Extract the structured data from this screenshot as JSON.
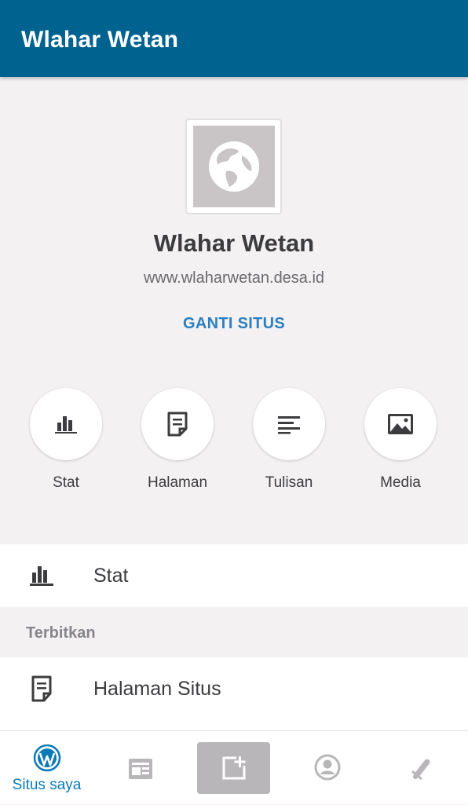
{
  "appbar": {
    "title": "Wlahar Wetan"
  },
  "site": {
    "name": "Wlahar Wetan",
    "url": "www.wlaharwetan.desa.id",
    "switch_label": "GANTI SITUS",
    "icon": "globe-icon"
  },
  "quick_actions": [
    {
      "label": "Stat",
      "icon": "bar-chart-icon"
    },
    {
      "label": "Halaman",
      "icon": "page-icon"
    },
    {
      "label": "Tulisan",
      "icon": "posts-icon"
    },
    {
      "label": "Media",
      "icon": "image-icon"
    }
  ],
  "list": {
    "stat_row": {
      "label": "Stat",
      "icon": "bar-chart-icon"
    },
    "publish_section": {
      "label": "Terbitkan"
    },
    "pages_row": {
      "label": "Halaman Situs",
      "icon": "page-icon"
    }
  },
  "bottom_nav": {
    "items": [
      {
        "label": "Situs saya",
        "icon": "wordpress-icon",
        "active": true
      },
      {
        "label": "",
        "icon": "reader-icon",
        "active": false
      },
      {
        "label": "",
        "icon": "write-icon",
        "active": false
      },
      {
        "label": "",
        "icon": "profile-icon",
        "active": false
      },
      {
        "label": "",
        "icon": "notifications-icon",
        "active": false
      }
    ]
  },
  "colors": {
    "appbar": "#00638f",
    "accent": "#2d7fbf",
    "active_nav": "#0a7ab6",
    "background": "#f3f1f2"
  }
}
